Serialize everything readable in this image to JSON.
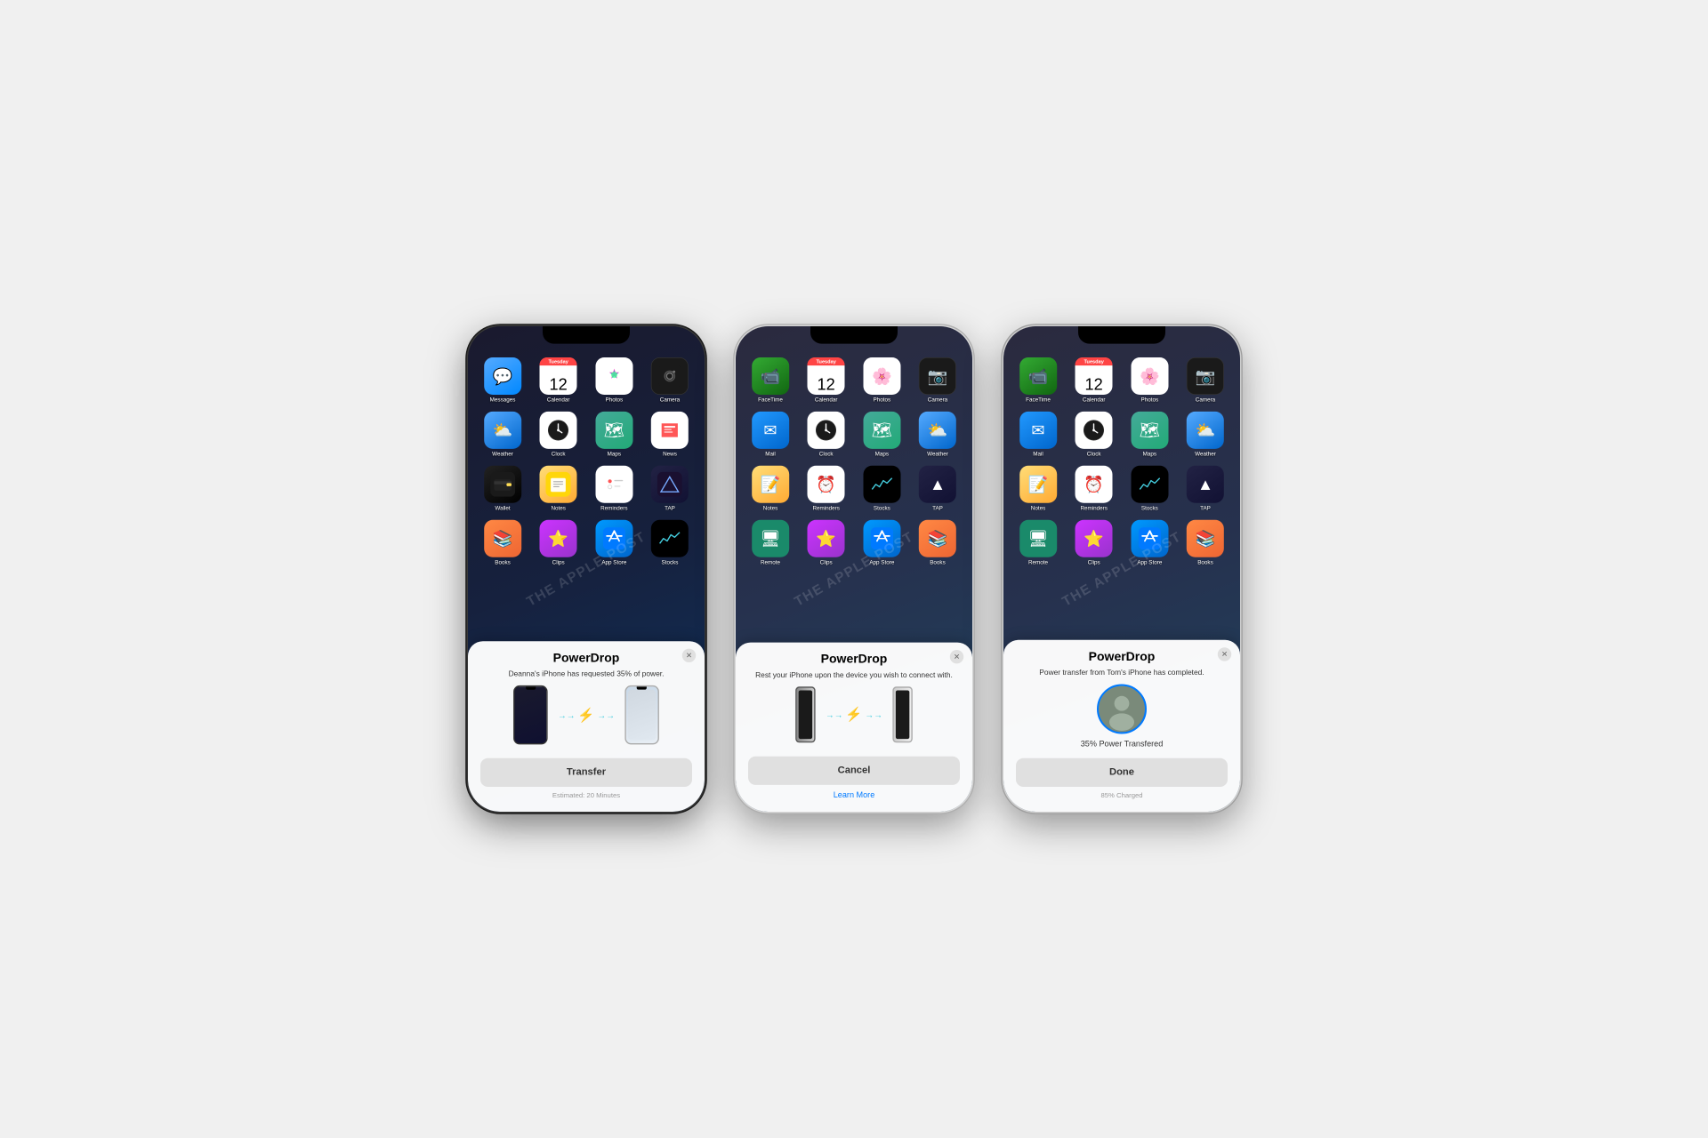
{
  "page": {
    "background": "#f0f0f0"
  },
  "phones": [
    {
      "id": "phone1",
      "frame_style": "dark",
      "screen_bg": "dark",
      "apps_row1": [
        {
          "name": "Messages",
          "icon_class": "ic-messages",
          "symbol": "💬"
        },
        {
          "name": "Calendar",
          "icon_class": "ic-calendar",
          "symbol": "12",
          "day": "Tuesday"
        },
        {
          "name": "Photos",
          "icon_class": "ic-photos",
          "symbol": "🌸"
        },
        {
          "name": "Camera",
          "icon_class": "ic-camera",
          "symbol": "📷"
        }
      ],
      "apps_row2": [
        {
          "name": "Weather",
          "icon_class": "ic-weather",
          "symbol": "⛅"
        },
        {
          "name": "Clock",
          "icon_class": "ic-clock",
          "symbol": "🕐"
        },
        {
          "name": "Maps",
          "icon_class": "ic-maps",
          "symbol": "🗺"
        },
        {
          "name": "News",
          "icon_class": "ic-news",
          "symbol": "📰"
        }
      ],
      "apps_row3": [
        {
          "name": "Wallet",
          "icon_class": "ic-wallet",
          "symbol": "💳"
        },
        {
          "name": "Notes",
          "icon_class": "ic-notes",
          "symbol": "📝"
        },
        {
          "name": "Reminders",
          "icon_class": "ic-reminders",
          "symbol": "⏰"
        },
        {
          "name": "TAP",
          "icon_class": "ic-tap",
          "symbol": "▲"
        }
      ],
      "apps_row4": [
        {
          "name": "Books",
          "icon_class": "ic-books",
          "symbol": "📚"
        },
        {
          "name": "Star",
          "icon_class": "ic-star",
          "symbol": "⭐"
        },
        {
          "name": "App Store",
          "icon_class": "ic-appstore",
          "symbol": "A"
        },
        {
          "name": "Stocks",
          "icon_class": "ic-stocks",
          "symbol": "📈"
        }
      ],
      "modal": {
        "title": "PowerDrop",
        "subtitle": "Deanna's iPhone has requested 35% of power.",
        "button_label": "Transfer",
        "footer": "Estimated: 20 Minutes",
        "type": "transfer",
        "show_close": true
      }
    },
    {
      "id": "phone2",
      "frame_style": "silver",
      "screen_bg": "medium",
      "apps_row1": [
        {
          "name": "FaceTime",
          "icon_class": "ic-facetime",
          "symbol": "📹"
        },
        {
          "name": "Calendar",
          "icon_class": "ic-calendar",
          "symbol": "12",
          "day": "Tuesday"
        },
        {
          "name": "Photos",
          "icon_class": "ic-photos",
          "symbol": "🌸"
        },
        {
          "name": "Camera",
          "icon_class": "ic-camera",
          "symbol": "📷"
        }
      ],
      "apps_row2": [
        {
          "name": "Mail",
          "icon_class": "ic-mail",
          "symbol": "✉"
        },
        {
          "name": "Clock",
          "icon_class": "ic-clock",
          "symbol": "🕐"
        },
        {
          "name": "Maps",
          "icon_class": "ic-maps",
          "symbol": "🗺"
        },
        {
          "name": "Weather",
          "icon_class": "ic-weather",
          "symbol": "⛅"
        }
      ],
      "apps_row3": [
        {
          "name": "Notes",
          "icon_class": "ic-notes",
          "symbol": "📝"
        },
        {
          "name": "Reminders",
          "icon_class": "ic-reminders",
          "symbol": "⏰"
        },
        {
          "name": "Stocks",
          "icon_class": "ic-stocks",
          "symbol": "📈"
        },
        {
          "name": "TAP",
          "icon_class": "ic-tap",
          "symbol": "▲"
        }
      ],
      "apps_row4": [
        {
          "name": "Screen",
          "icon_class": "ic-maps",
          "symbol": "🖥"
        },
        {
          "name": "Star",
          "icon_class": "ic-star",
          "symbol": "⭐"
        },
        {
          "name": "App Store",
          "icon_class": "ic-appstore",
          "symbol": "A"
        },
        {
          "name": "Books",
          "icon_class": "ic-books",
          "symbol": "📚"
        }
      ],
      "modal": {
        "title": "PowerDrop",
        "subtitle": "Rest your iPhone upon the device you wish to connect with.",
        "button_label": "Cancel",
        "link_label": "Learn More",
        "type": "place",
        "show_close": true
      }
    },
    {
      "id": "phone3",
      "frame_style": "silver2",
      "screen_bg": "medium",
      "apps_row1": [
        {
          "name": "FaceTime",
          "icon_class": "ic-facetime",
          "symbol": "📹"
        },
        {
          "name": "Calendar",
          "icon_class": "ic-calendar",
          "symbol": "12",
          "day": "Tuesday"
        },
        {
          "name": "Photos",
          "icon_class": "ic-photos",
          "symbol": "🌸"
        },
        {
          "name": "Camera",
          "icon_class": "ic-camera",
          "symbol": "📷"
        }
      ],
      "apps_row2": [
        {
          "name": "Mail",
          "icon_class": "ic-mail",
          "symbol": "✉"
        },
        {
          "name": "Clock",
          "icon_class": "ic-clock",
          "symbol": "🕐"
        },
        {
          "name": "Maps",
          "icon_class": "ic-maps",
          "symbol": "🗺"
        },
        {
          "name": "Weather",
          "icon_class": "ic-weather",
          "symbol": "⛅"
        }
      ],
      "apps_row3": [
        {
          "name": "Notes",
          "icon_class": "ic-notes",
          "symbol": "📝"
        },
        {
          "name": "Reminders",
          "icon_class": "ic-reminders",
          "symbol": "⏰"
        },
        {
          "name": "Stocks",
          "icon_class": "ic-stocks",
          "symbol": "📈"
        },
        {
          "name": "TAP",
          "icon_class": "ic-tap",
          "symbol": "▲"
        }
      ],
      "apps_row4": [
        {
          "name": "Screen",
          "icon_class": "ic-maps",
          "symbol": "🖥"
        },
        {
          "name": "Star",
          "icon_class": "ic-star",
          "symbol": "⭐"
        },
        {
          "name": "App Store",
          "icon_class": "ic-appstore",
          "symbol": "A"
        },
        {
          "name": "Books",
          "icon_class": "ic-books",
          "symbol": "📚"
        }
      ],
      "modal": {
        "title": "PowerDrop",
        "subtitle": "Power transfer from Tom's iPhone has completed.",
        "button_label": "Done",
        "footer": "85% Charged",
        "power_text": "35% Power Transfered",
        "type": "complete",
        "show_close": true
      }
    }
  ],
  "watermark": "THE APPLE POST"
}
